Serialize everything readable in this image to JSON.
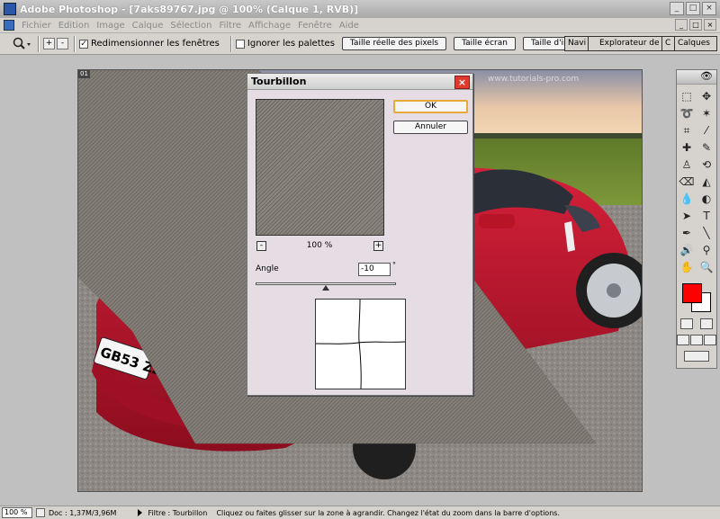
{
  "window": {
    "title": "Adobe Photoshop - [7aks89767.jpg @ 100% (Calque 1, RVB)]",
    "buttons": [
      "_",
      "□",
      "×"
    ]
  },
  "menu": {
    "items": [
      "Fichier",
      "Edition",
      "Image",
      "Calque",
      "Sélection",
      "Filtre",
      "Affichage",
      "Fenêtre",
      "Aide"
    ]
  },
  "options": {
    "resize_windows_label": "Redimensionner les fenêtres",
    "resize_windows_checked": true,
    "ignore_palettes_label": "Ignorer les palettes",
    "ignore_palettes_checked": false,
    "actual_pixels": "Taille réelle des pixels",
    "fit_screen": "Taille écran",
    "print_size": "Taille d'impression",
    "palette_tabs": [
      "Navi",
      "Explorateur de fic",
      "C",
      "Calques"
    ]
  },
  "document": {
    "tag": "01",
    "watermark": "www.tutorials-pro.com"
  },
  "dialog": {
    "title": "Tourbillon",
    "ok_label": "OK",
    "cancel_label": "Annuler",
    "zoom_out": "-",
    "zoom_in": "+",
    "zoom_value": "100 %",
    "angle_label": "Angle",
    "angle_value": "-10",
    "degree_symbol": "°",
    "slider_value": -10
  },
  "toolbox": {
    "foreground_color": "#ff0000",
    "background_color": "#ffffff"
  },
  "status": {
    "zoom": "100 %",
    "doc": "Doc : 1,37M/3,96M",
    "message": "Filtre : Tourbillon    Cliquez ou faites glisser sur la zone à agrandir. Changez l'état du zoom dans la barre d'options."
  }
}
